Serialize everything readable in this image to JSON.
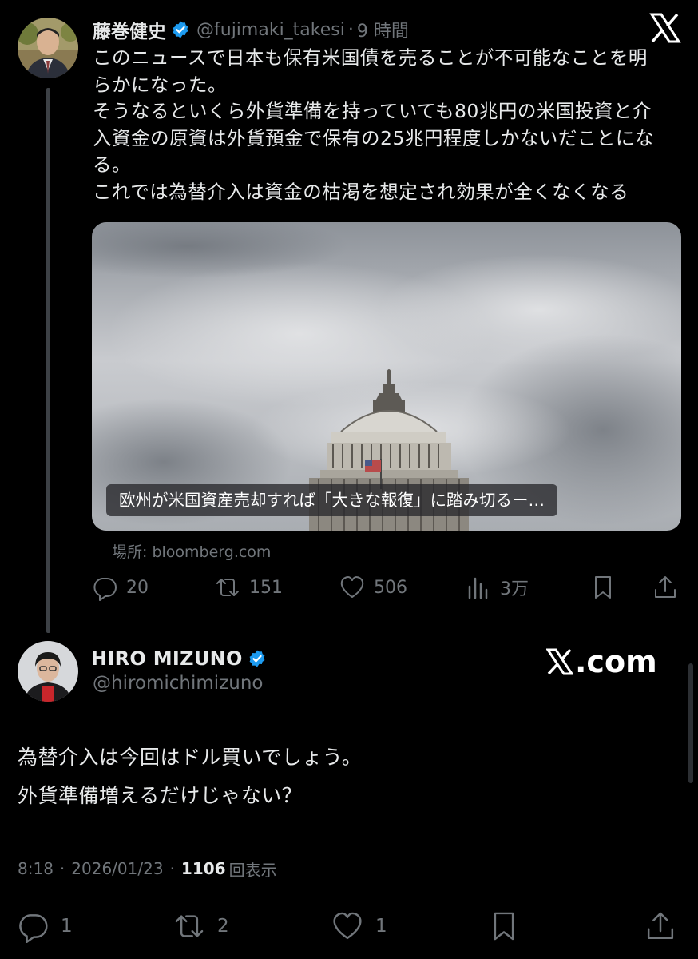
{
  "quoted": {
    "author_name": "藤巻健史",
    "handle": "@fujimaki_takesi",
    "time": "9 時間",
    "body_lines": [
      "このニュースで日本も保有米国債を売ることが不可能なことを明",
      "らかになった。",
      "そうなるといくら外貨準備を持っていても80兆円の米国投資と介",
      "入資金の原資は外貨預金で保有の25兆円程度しかないだことにな",
      "る。",
      "これでは為替介入は資金の枯渇を想定され効果が全くなくなる"
    ],
    "card": {
      "caption": "欧州が米国資産売却すれば「大きな報復」に踏み切るー…",
      "source": "場所: bloomberg.com"
    },
    "actions": {
      "replies": "20",
      "reposts": "151",
      "likes": "506",
      "views": "3万"
    }
  },
  "main": {
    "author_name": "HIRO MIZUNO",
    "handle": "@hiromichimizuno",
    "brand": ".com",
    "body_lines": [
      "為替介入は今回はドル買いでしょう。",
      "外貨準備増えるだけじゃない？"
    ],
    "time": "8:18",
    "date": "2026/01/23",
    "views_count": "1106",
    "views_label": "回表示",
    "separator": "·",
    "actions": {
      "replies": "1",
      "reposts": "2",
      "likes": "1"
    }
  },
  "icons": [
    "verified-badge-icon",
    "x-logo-icon",
    "reply-icon",
    "repost-icon",
    "like-icon",
    "views-icon",
    "bookmark-icon",
    "share-icon"
  ],
  "colors": {
    "background": "#000000",
    "text": "#e7e9ea",
    "muted": "#71767b",
    "verified": "#1d9bf0"
  }
}
